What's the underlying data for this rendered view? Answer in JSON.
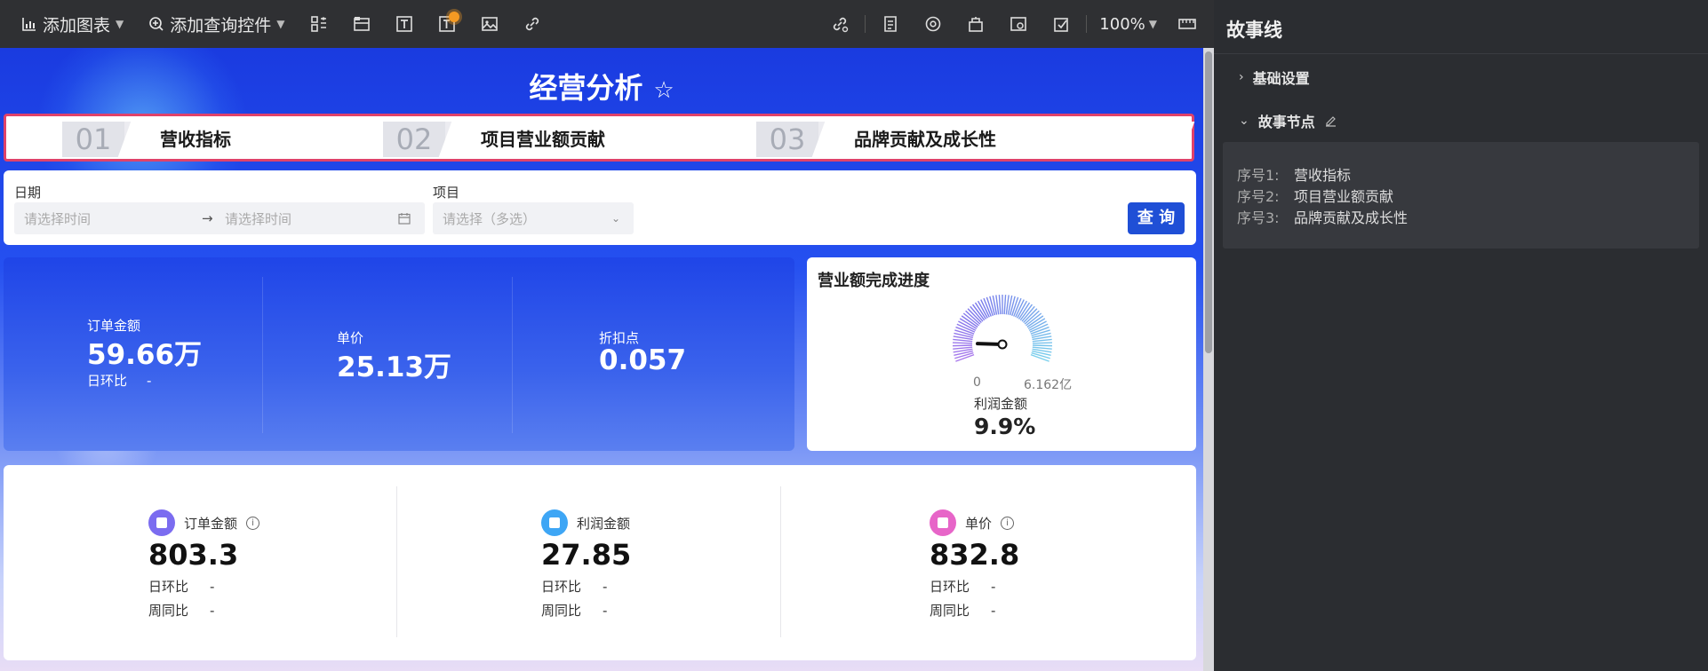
{
  "toolbar": {
    "add_chart": "添加图表",
    "add_query": "添加查询控件",
    "zoom": "100%"
  },
  "dashboard": {
    "title": "经营分析",
    "story_tabs": [
      {
        "num": "01",
        "label": "营收指标"
      },
      {
        "num": "02",
        "label": "项目营业额贡献"
      },
      {
        "num": "03",
        "label": "品牌贡献及成长性"
      }
    ],
    "filters": {
      "date_label": "日期",
      "date_start_placeholder": "请选择时间",
      "date_end_placeholder": "请选择时间",
      "project_label": "项目",
      "project_placeholder": "请选择（多选）",
      "query_button": "查 询"
    },
    "kpis": [
      {
        "label": "订单金额",
        "value": "59.66万",
        "compare_label": "日环比",
        "compare_value": "-"
      },
      {
        "label": "单价",
        "value": "25.13万"
      },
      {
        "label": "折扣点",
        "value": "0.057"
      }
    ],
    "gauge": {
      "title": "营业额完成进度",
      "min_label": "0",
      "max_label": "6.162亿",
      "metric_label": "利润金额",
      "value_label": "9.9%",
      "progress": 0.099
    },
    "summary": [
      {
        "label": "订单金额",
        "value": "803.3",
        "day_label": "日环比",
        "day_value": "-",
        "week_label": "周同比",
        "week_value": "-",
        "color": "#7b6cf0"
      },
      {
        "label": "利润金额",
        "value": "27.85",
        "day_label": "日环比",
        "day_value": "-",
        "week_label": "周同比",
        "week_value": "-",
        "color": "#3ea6f5"
      },
      {
        "label": "单价",
        "value": "832.8",
        "day_label": "日环比",
        "day_value": "-",
        "week_label": "周同比",
        "week_value": "-",
        "color": "#e765c8"
      }
    ]
  },
  "panel": {
    "title": "故事线",
    "basic_settings": "基础设置",
    "story_nodes": "故事节点",
    "nodes": [
      {
        "key": "序号1:",
        "value": "营收指标"
      },
      {
        "key": "序号2:",
        "value": "项目营业额贡献"
      },
      {
        "key": "序号3:",
        "value": "品牌贡献及成长性"
      }
    ]
  }
}
